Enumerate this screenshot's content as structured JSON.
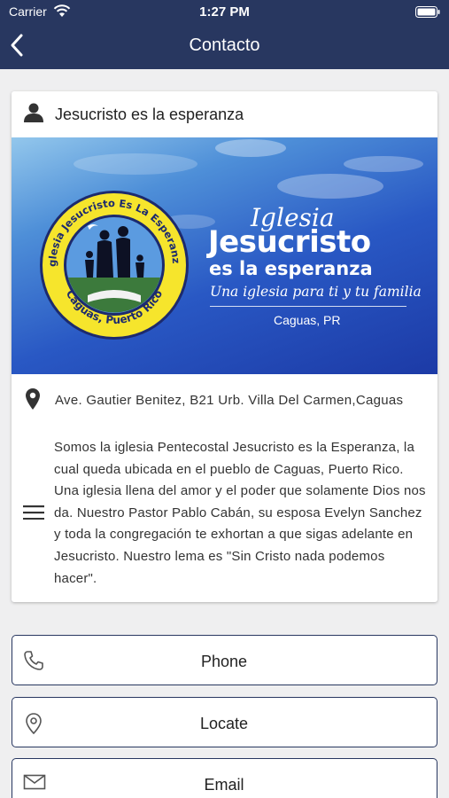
{
  "status_bar": {
    "carrier": "Carrier",
    "time": "1:27 PM"
  },
  "nav": {
    "title": "Contacto",
    "back_icon": "chevron-left-icon"
  },
  "card": {
    "title": "Jesucristo es la esperanza",
    "banner": {
      "emblem_top_text": "Iglesia Jesucristo Es La Esperanza",
      "emblem_bottom_text": "Caguas, Puerto Rico",
      "iglesia": "Iglesia",
      "jesucristo": "Jesucristo",
      "es_la_esperanza": "es la esperanza",
      "tagline": "Una iglesia para ti y tu familia",
      "place": "Caguas, PR"
    },
    "address": "Ave. Gautier Benitez, B21 Urb. Villa Del Carmen,Caguas",
    "description": " Somos la iglesia Pentecostal Jesucristo es la Esperanza, la cual queda ubicada en el pueblo de Caguas, Puerto Rico. Una iglesia llena del amor y el poder que solamente Dios nos da. Nuestro Pastor Pablo Cabán, su esposa Evelyn Sanchez y toda la congregación te exhortan a que sigas adelante en Jesucristo. Nuestro lema es \"Sin Cristo nada podemos hacer\"."
  },
  "buttons": {
    "phone": "Phone",
    "locate": "Locate",
    "email": "Email"
  },
  "colors": {
    "navbar": "#283760",
    "button_border": "#283760",
    "background": "#efeff0"
  }
}
